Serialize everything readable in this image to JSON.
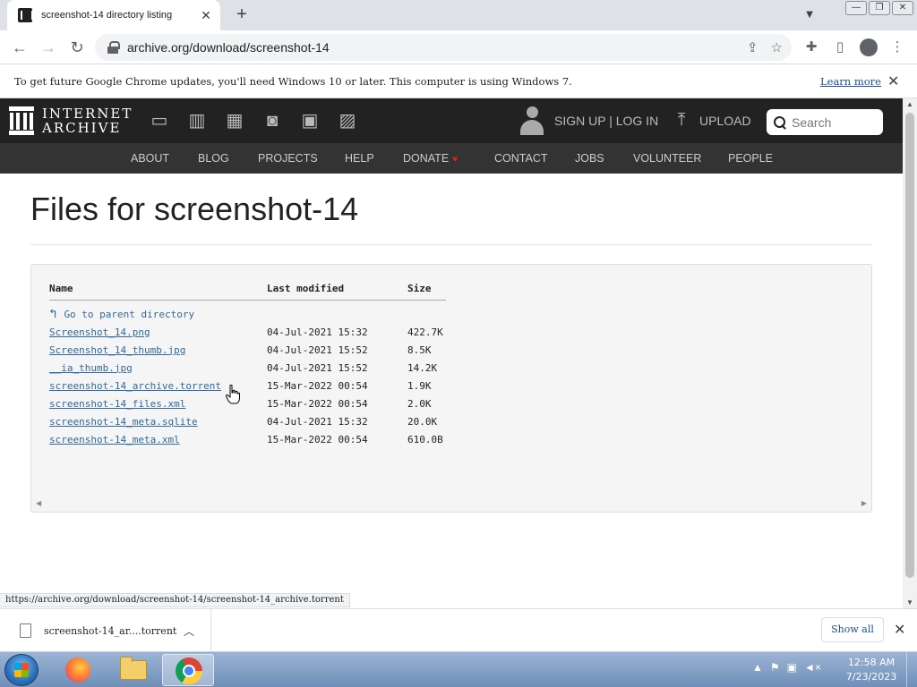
{
  "browser": {
    "tab_title": "screenshot-14 directory listing",
    "tab_close": "✕",
    "new_tab": "+",
    "url": "archive.org/download/screenshot-14",
    "status_url": "https://archive.org/download/screenshot-14/screenshot-14_archive.torrent"
  },
  "infobar": {
    "message": "To get future Google Chrome updates, you'll need Windows 10 or later. This computer is using Windows 7.",
    "learn_more": "Learn more"
  },
  "ia": {
    "logo_line1": "INTERNET",
    "logo_line2": "ARCHIVE",
    "signup": "SIGN UP | LOG IN",
    "upload": "UPLOAD",
    "search_placeholder": "Search",
    "nav": {
      "about": "ABOUT",
      "blog": "BLOG",
      "projects": "PROJECTS",
      "help": "HELP",
      "donate": "DONATE",
      "contact": "CONTACT",
      "jobs": "JOBS",
      "volunteer": "VOLUNTEER",
      "people": "PEOPLE"
    },
    "accent_color": "#e2231a"
  },
  "page": {
    "title": "Files for screenshot-14",
    "columns": {
      "name": "Name",
      "modified": "Last modified",
      "size": "Size"
    },
    "parent_link": "Go to parent directory",
    "files": [
      {
        "name": "Screenshot_14.png",
        "modified": "04-Jul-2021 15:32",
        "size": "422.7K"
      },
      {
        "name": "Screenshot_14_thumb.jpg",
        "modified": "04-Jul-2021 15:52",
        "size": "8.5K"
      },
      {
        "name": "__ia_thumb.jpg",
        "modified": "04-Jul-2021 15:52",
        "size": "14.2K"
      },
      {
        "name": "screenshot-14_archive.torrent",
        "modified": "15-Mar-2022 00:54",
        "size": "1.9K"
      },
      {
        "name": "screenshot-14_files.xml",
        "modified": "15-Mar-2022 00:54",
        "size": "2.0K"
      },
      {
        "name": "screenshot-14_meta.sqlite",
        "modified": "04-Jul-2021 15:32",
        "size": "20.0K"
      },
      {
        "name": "screenshot-14_meta.xml",
        "modified": "15-Mar-2022 00:54",
        "size": "610.0B"
      }
    ]
  },
  "downloads": {
    "item_name": "screenshot-14_ar....torrent",
    "show_all": "Show all"
  },
  "taskbar": {
    "time": "12:58 AM",
    "date": "7/23/2023"
  }
}
